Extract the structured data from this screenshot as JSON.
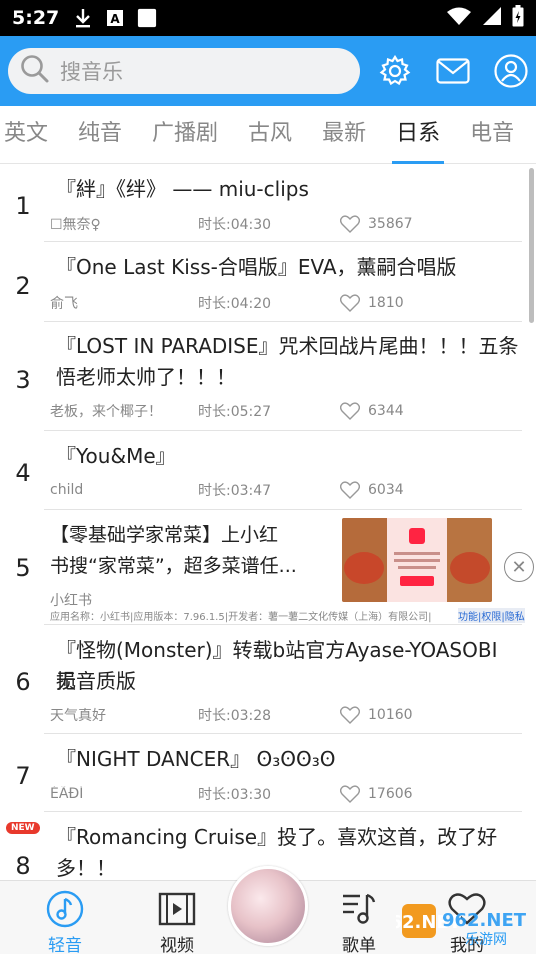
{
  "status_bar": {
    "time": "5:27",
    "icons": [
      "download-icon",
      "a-icon",
      "square-icon",
      "wifi-icon",
      "signal-icon",
      "battery-icon"
    ]
  },
  "search": {
    "placeholder": "搜音乐"
  },
  "header_icons": [
    "settings-icon",
    "mail-icon",
    "user-icon"
  ],
  "tabs": [
    {
      "label": "英文",
      "active": false
    },
    {
      "label": "纯音",
      "active": false
    },
    {
      "label": "广播剧",
      "active": false
    },
    {
      "label": "古风",
      "active": false
    },
    {
      "label": "最新",
      "active": false
    },
    {
      "label": "日系",
      "active": true
    },
    {
      "label": "电音",
      "active": false
    }
  ],
  "songs": [
    {
      "rank": "1",
      "title_lines": [
        "『絆』《绊》 —— miu-clips"
      ],
      "artist": "☐無奈♀",
      "duration": "时长:04:30",
      "likes": "35867"
    },
    {
      "rank": "2",
      "title_lines": [
        "『One Last Kiss-合唱版』EVA，薰嗣合唱版"
      ],
      "artist": "俞飞",
      "duration": "时长:04:20",
      "likes": "1810"
    },
    {
      "rank": "3",
      "title_lines": [
        "『LOST IN PARADISE』咒术回战片尾曲！！！五条",
        "悟老师太帅了！！！"
      ],
      "artist": "老板，来个椰子！",
      "duration": "时长:05:27",
      "likes": "6344"
    },
    {
      "rank": "4",
      "title_lines": [
        "『You&Me』"
      ],
      "artist": "child",
      "duration": "时长:03:47",
      "likes": "6034"
    },
    {
      "rank": "6",
      "title_lines": [
        "『怪物(Monster)』转载b站官方Ayase-YOASOBI 无",
        "损音质版"
      ],
      "artist": "天气真好",
      "duration": "时长:03:28",
      "likes": "10160"
    },
    {
      "rank": "7",
      "title_lines": [
        "『NIGHT DANCER』 ʘ₃ʘʘ₃ʘ"
      ],
      "artist": "ÉÃĐÍ",
      "duration": "时长:03:30",
      "likes": "17606"
    },
    {
      "rank": "8",
      "title_lines": [
        "『Romancing Cruise』投了。喜欢这首，改了好",
        "多！！"
      ],
      "artist": "",
      "duration": "",
      "likes": ""
    }
  ],
  "ad": {
    "rank": "5",
    "title_lines": [
      "【零基础学家常菜】上小红",
      "书搜“家常菜”，超多菜谱任..."
    ],
    "source": "小红书",
    "info": "应用名称：小红书|应用版本：7.96.1.5|开发者：薯一薯二文化传媒（上海）有限公司|",
    "links": "功能|权限|隐私",
    "close_icon": "close-icon"
  },
  "new_badge": "NEW",
  "bottom_nav": [
    {
      "label": "轻音",
      "icon": "music-note-icon",
      "active": true
    },
    {
      "label": "视频",
      "icon": "film-icon",
      "active": false
    },
    {
      "label": "歌单",
      "icon": "playlist-icon",
      "active": false
    },
    {
      "label": "我的",
      "icon": "heart-icon",
      "active": false
    }
  ],
  "watermark": {
    "text": "962.NET",
    "sub": "乐游网"
  }
}
